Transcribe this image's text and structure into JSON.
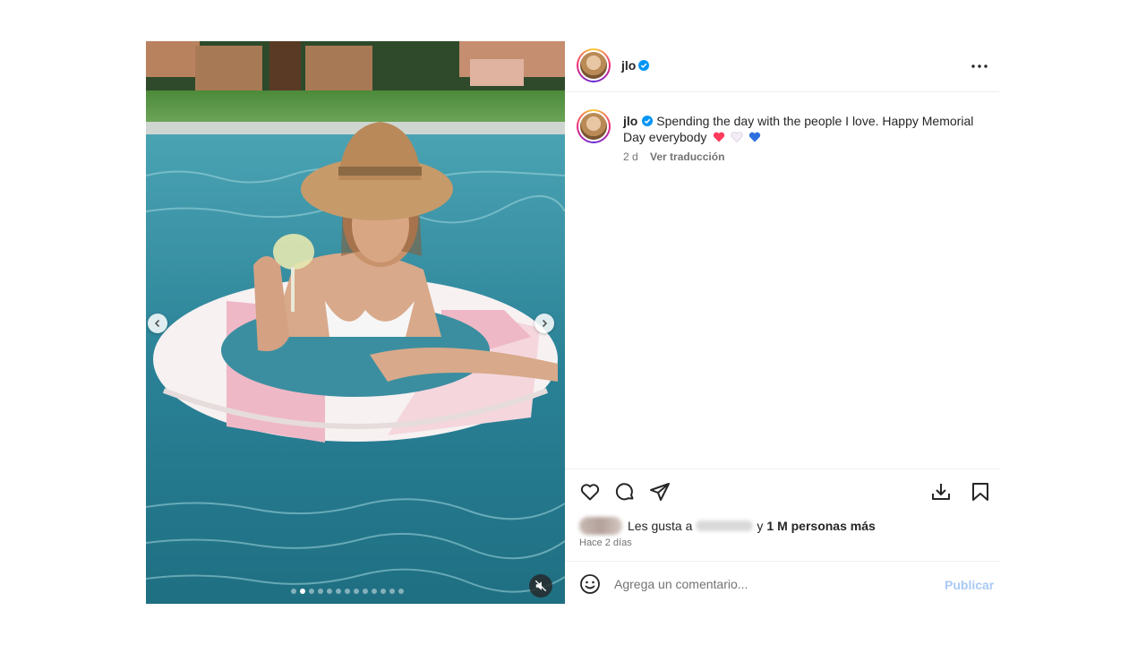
{
  "post": {
    "username": "jlo",
    "caption_text": "Spending the day with the people I love. Happy Memorial Day everybody",
    "caption_emojis": [
      "heart-red",
      "heart-white",
      "heart-blue"
    ],
    "time_short": "2 d",
    "translate_label": "Ver traducción",
    "likes_prefix": "Les gusta a",
    "likes_conjunction": "y",
    "likes_count_text": "1 M personas más",
    "time_long": "Hace 2 días",
    "comment_placeholder": "Agrega un comentario...",
    "publish_label": "Publicar"
  },
  "carousel": {
    "total_slides": 13,
    "active_index": 1
  },
  "colors": {
    "verified": "#0095f6",
    "link_disabled": "#a9c9f5",
    "text": "#262626",
    "muted": "#737373",
    "heart_red": "#ff3b5c",
    "heart_blue": "#2f6fe0"
  },
  "icons": [
    "chevron-left-icon",
    "chevron-right-icon",
    "mute-icon",
    "more-icon",
    "heart-icon",
    "comment-icon",
    "share-icon",
    "download-icon",
    "bookmark-icon",
    "emoji-icon",
    "verified-icon"
  ]
}
